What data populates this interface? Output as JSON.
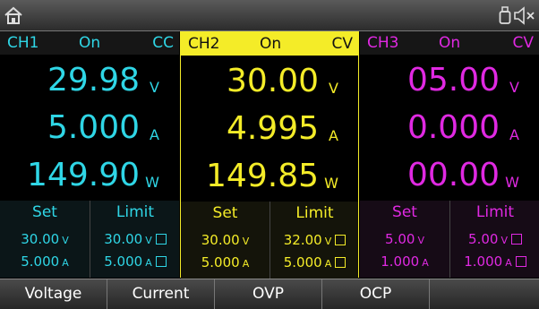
{
  "icons": {
    "home": "home-icon",
    "usb": "usb-icon",
    "mute": "speaker-mute-icon"
  },
  "colors": {
    "ch1": "#2fd6e6",
    "ch2": "#f4ec28",
    "ch3": "#e029e2"
  },
  "channels": [
    {
      "name": "CH1",
      "state": "On",
      "mode": "CC",
      "voltage": "29.98",
      "voltage_unit": "V",
      "current": "5.000",
      "current_unit": "A",
      "power": "149.90",
      "power_unit": "W",
      "set_label": "Set",
      "limit_label": "Limit",
      "set_voltage": "30.00",
      "set_current": "5.000",
      "limit_voltage": "30.00",
      "limit_current": "5.000",
      "unit_v": "V",
      "unit_a": "A"
    },
    {
      "name": "CH2",
      "state": "On",
      "mode": "CV",
      "voltage": "30.00",
      "voltage_unit": "V",
      "current": "4.995",
      "current_unit": "A",
      "power": "149.85",
      "power_unit": "W",
      "set_label": "Set",
      "limit_label": "Limit",
      "set_voltage": "30.00",
      "set_current": "5.000",
      "limit_voltage": "32.00",
      "limit_current": "5.000",
      "unit_v": "V",
      "unit_a": "A"
    },
    {
      "name": "CH3",
      "state": "On",
      "mode": "CV",
      "voltage": "05.00",
      "voltage_unit": "V",
      "current": "0.000",
      "current_unit": "A",
      "power": "00.00",
      "power_unit": "W",
      "set_label": "Set",
      "limit_label": "Limit",
      "set_voltage": "5.00",
      "set_current": "1.000",
      "limit_voltage": "5.00",
      "limit_current": "1.000",
      "unit_v": "V",
      "unit_a": "A"
    }
  ],
  "softkeys": [
    "Voltage",
    "Current",
    "OVP",
    "OCP",
    ""
  ]
}
